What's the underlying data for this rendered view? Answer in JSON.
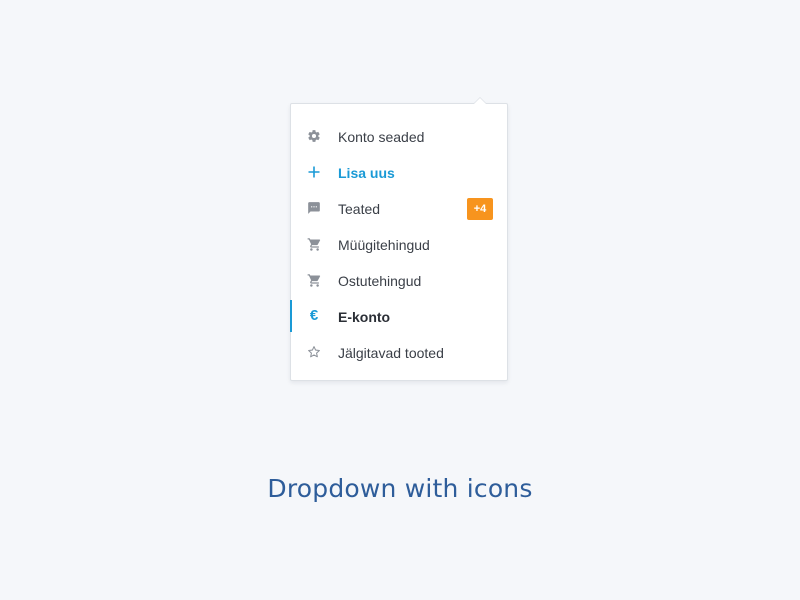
{
  "dropdown": {
    "items": [
      {
        "label": "Konto seaded",
        "icon": "gear-icon",
        "state": "default"
      },
      {
        "label": "Lisa uus",
        "icon": "plus-icon",
        "state": "accent"
      },
      {
        "label": "Teated",
        "icon": "message-icon",
        "state": "default",
        "badge": "+4"
      },
      {
        "label": "Müügitehingud",
        "icon": "cart-icon",
        "state": "default"
      },
      {
        "label": "Ostutehingud",
        "icon": "cart-icon",
        "state": "default"
      },
      {
        "label": "E-konto",
        "icon": "euro-icon",
        "state": "active"
      },
      {
        "label": "Jälgitavad tooted",
        "icon": "star-icon",
        "state": "default"
      }
    ]
  },
  "caption": "Dropdown with icons",
  "colors": {
    "accent": "#1a9ad6",
    "badge": "#f7941e",
    "caption": "#2e5d9a",
    "background": "#f5f7fa"
  }
}
